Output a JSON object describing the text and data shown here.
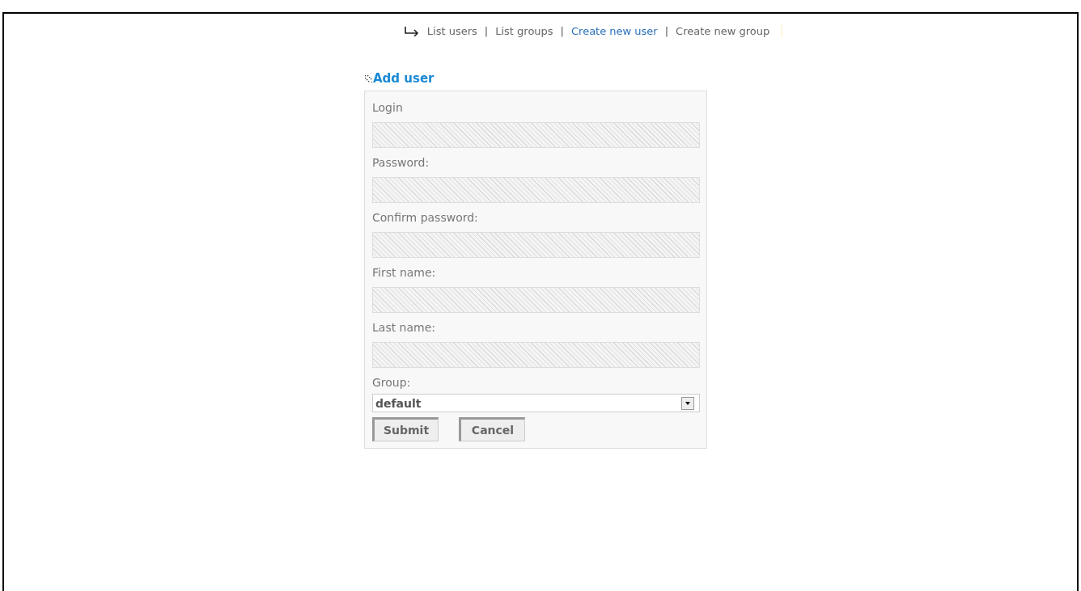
{
  "nav": {
    "separator": "|",
    "items": [
      {
        "label": "List users",
        "selected": false
      },
      {
        "label": "List groups",
        "selected": false
      },
      {
        "label": "Create new user",
        "selected": true
      },
      {
        "label": "Create new group",
        "selected": false
      }
    ]
  },
  "form": {
    "title": "Add user",
    "fields": [
      {
        "kind": "text",
        "label": "Login"
      },
      {
        "kind": "text",
        "label": "Password:"
      },
      {
        "kind": "text",
        "label": "Confirm password:"
      },
      {
        "kind": "text",
        "label": "First name:"
      },
      {
        "kind": "text",
        "label": "Last name:"
      },
      {
        "kind": "select",
        "label": "Group:",
        "value": "default"
      }
    ],
    "buttons": [
      "Submit",
      "Cancel"
    ]
  }
}
